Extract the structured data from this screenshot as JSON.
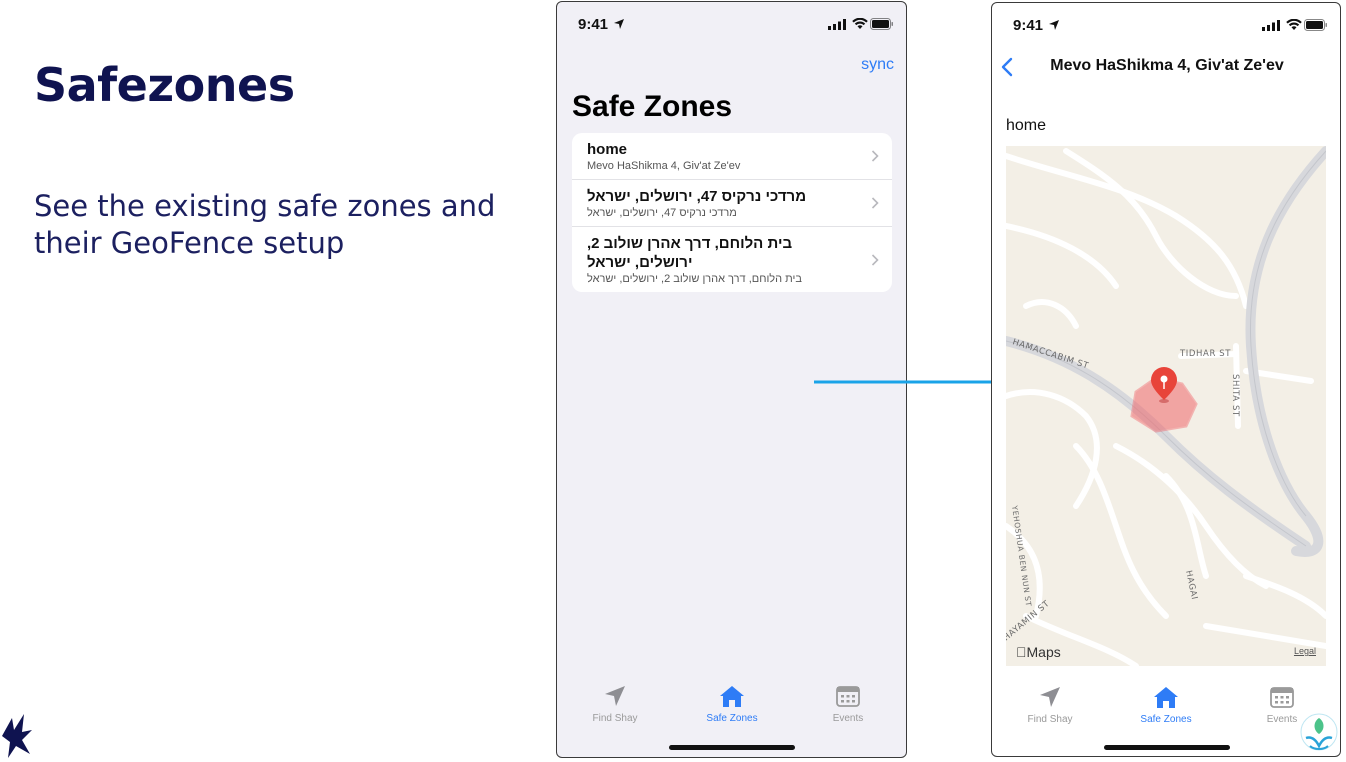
{
  "slide": {
    "title": "Safezones",
    "description": "See the existing safe zones and their GeoFence setup"
  },
  "colors": {
    "accent": "#2e7cf6",
    "title_navy": "#0f1350",
    "arrow": "#1aa3e8",
    "geofence": "#f0676b"
  },
  "left_phone": {
    "status": {
      "time": "9:41"
    },
    "nav": {
      "sync_label": "sync"
    },
    "title": "Safe Zones",
    "zones": [
      {
        "name": "home",
        "address": "Mevo HaShikma 4, Giv'at Ze'ev"
      },
      {
        "name": "מרדכי נרקיס 47, ירושלים, ישראל",
        "address": "מרדכי נרקיס 47, ירושלים, ישראל"
      },
      {
        "name": "בית הלוחם, דרך אהרן שולוב 2, ירושלים, ישראל",
        "address": "בית הלוחם, דרך אהרן שולוב 2, ירושלים, ישראל"
      }
    ],
    "tabs": [
      {
        "label": "Find Shay",
        "icon": "location-arrow-icon",
        "active": false
      },
      {
        "label": "Safe Zones",
        "icon": "house-icon",
        "active": true
      },
      {
        "label": "Events",
        "icon": "calendar-icon",
        "active": false
      }
    ]
  },
  "right_phone": {
    "status": {
      "time": "9:41"
    },
    "nav": {
      "title": "Mevo HaShikma 4, Giv'at Ze'ev"
    },
    "zone_name": "home",
    "map": {
      "streets": [
        "HAMACCABIM ST",
        "TIDHAR ST",
        "SHITA ST",
        "YEHOSHUA BEN NUN ST",
        "HAGAI",
        "HAYAMIN ST"
      ],
      "brand": "Maps",
      "legal": "Legal"
    },
    "tabs": [
      {
        "label": "Find Shay",
        "icon": "location-arrow-icon",
        "active": false
      },
      {
        "label": "Safe Zones",
        "icon": "house-icon",
        "active": true
      },
      {
        "label": "Events",
        "icon": "calendar-icon",
        "active": false
      }
    ]
  }
}
